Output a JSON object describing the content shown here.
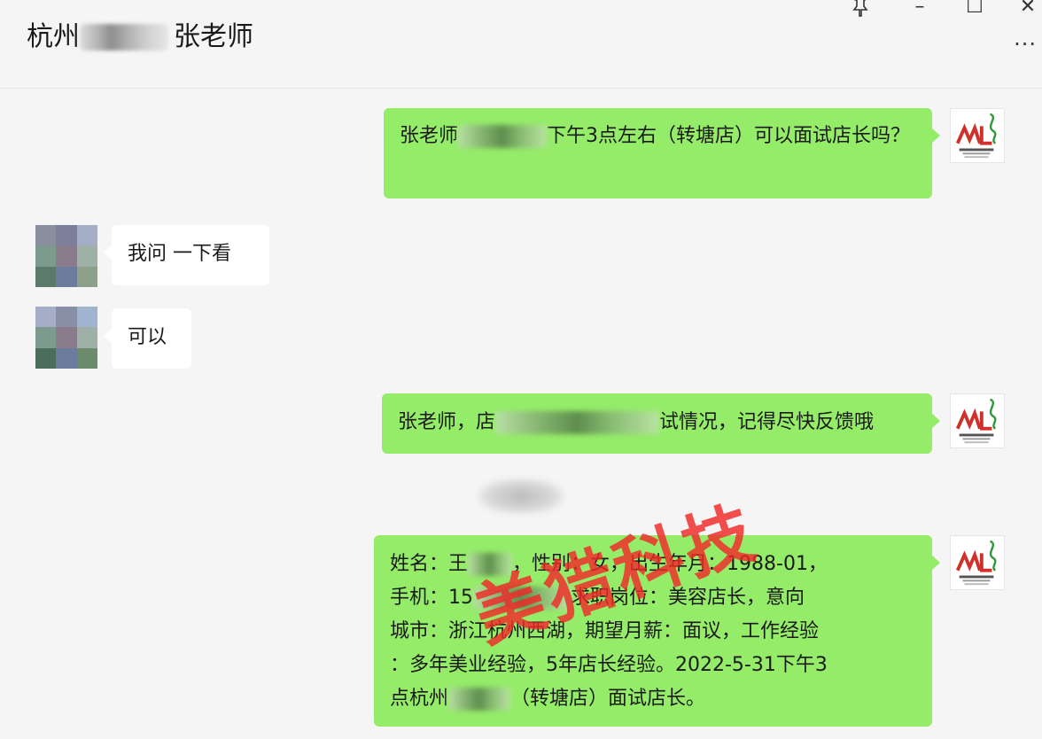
{
  "header": {
    "title_prefix": "杭州",
    "title_suffix": "张老师"
  },
  "window_controls": {
    "pin_icon": "pin-icon",
    "minimize": "–",
    "maximize": "☐",
    "close": "✕",
    "more": "···"
  },
  "messages": [
    {
      "direction": "out",
      "parts": [
        "张老师",
        "下午3点左右（转塘店）可以面试店长吗？"
      ]
    },
    {
      "direction": "in",
      "text": "我问 一下看"
    },
    {
      "direction": "in",
      "text": "可以"
    },
    {
      "direction": "out",
      "parts": [
        "张老师，店",
        "试情况，记得尽快反馈哦"
      ]
    },
    {
      "direction": "out",
      "lines": [
        "姓名：王",
        "，性别：女，出生年月：1988-01，",
        "手机：15",
        "求职岗位：美容店长，意向",
        "城市：浙江杭州西湖，期望月薪：面议，工作经验",
        "：多年美业经验，5年店长经验。2022-5-31下午3",
        "点杭州",
        "（转塘店）面试店长。"
      ]
    }
  ],
  "watermark": "美猎科技",
  "colors": {
    "outgoing_bubble": "#95ec69",
    "incoming_bubble": "#ffffff",
    "background": "#f5f5f5",
    "watermark": "#f02828",
    "logo_red": "#d0302a",
    "logo_green": "#2e9a3c"
  }
}
